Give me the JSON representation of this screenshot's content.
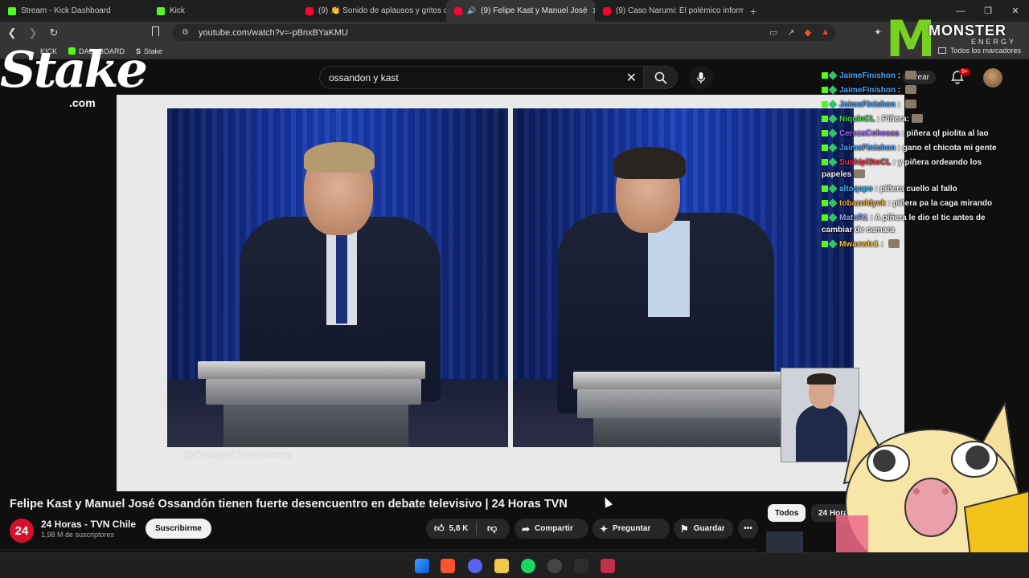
{
  "browser": {
    "tabs": [
      {
        "label": "Stream - Kick Dashboard",
        "icon": "kick-logo-icon",
        "active": false
      },
      {
        "label": "Kick",
        "icon": "kick-logo-icon",
        "active": false
      },
      {
        "label": "(9) 👏 Sonido de aplausos y gritos d",
        "icon": "youtube-logo-icon",
        "active": false
      },
      {
        "label": "(9) Felipe Kast y Manuel José",
        "icon": "youtube-logo-icon",
        "active": true
      },
      {
        "label": "(9) Caso Narumi: El polémico informe",
        "icon": "youtube-logo-icon",
        "active": false
      }
    ],
    "url": "youtube.com/watch?v=-pBnxBYaKMU",
    "bookmarks": [
      {
        "label": "KICK"
      },
      {
        "label": "DASHBOARD"
      },
      {
        "label": "Stake"
      }
    ],
    "all_bookmarks_label": "Todos los marcadores"
  },
  "youtube": {
    "search_query": "ossandon y kast",
    "create_label": "Crear",
    "notif_count": "9+",
    "video_title": "Felipe Kast y Manuel José Ossandón tienen fuerte desencuentro en debate televisivo | 24 Horas TVN",
    "channel": {
      "avatar_text": "24",
      "name": "24 Horas - TVN Chile",
      "subscribers": "1,98 M de suscriptores"
    },
    "subscribe_label": "Suscribirme",
    "likes": "5,8 K",
    "share_label": "Compartir",
    "ask_label": "Preguntar",
    "save_label": "Guardar",
    "chips": [
      "Todos",
      "24 Horas"
    ],
    "watermark": "@DebateCHileVamos"
  },
  "overlay": {
    "stake_logo": "Stake",
    "stake_com": ".com",
    "monster_word": "MONSTER",
    "monster_sub": "ENERGY"
  },
  "chat": [
    {
      "user": "JaimeFinishon",
      "color": "#4aa3ff",
      "text": ""
    },
    {
      "user": "JaimeFinishon",
      "color": "#4aa3ff",
      "text": ""
    },
    {
      "user": "JaimeFinishon",
      "color": "#4aa3ff",
      "text": ""
    },
    {
      "user": "NiquinCL",
      "color": "#3cd84a",
      "text": "Piñera:"
    },
    {
      "user": "CerezaCohesaa",
      "color": "#a666ff",
      "text": "piñera ql piolita al lao"
    },
    {
      "user": "JaimeFinishon",
      "color": "#4aa3ff",
      "text": "gano el chicota mi gente"
    },
    {
      "user": "Sushipl3toCL",
      "color": "#ff3344",
      "text": "y piñera ordeando los papeles"
    },
    {
      "user": "altoqapo",
      "color": "#3fb8ff",
      "text": "piñera cuello al fallo"
    },
    {
      "user": "tobazoldyck",
      "color": "#f2b23a",
      "text": "piñera pa la caga mirando"
    },
    {
      "user": "MatsR1",
      "color": "#8aa8ff",
      "text": "A piñera le dio el tic antes de cambiar de camara"
    },
    {
      "user": "Mwaxwix1",
      "color": "#f2c03a",
      "text": ""
    }
  ]
}
